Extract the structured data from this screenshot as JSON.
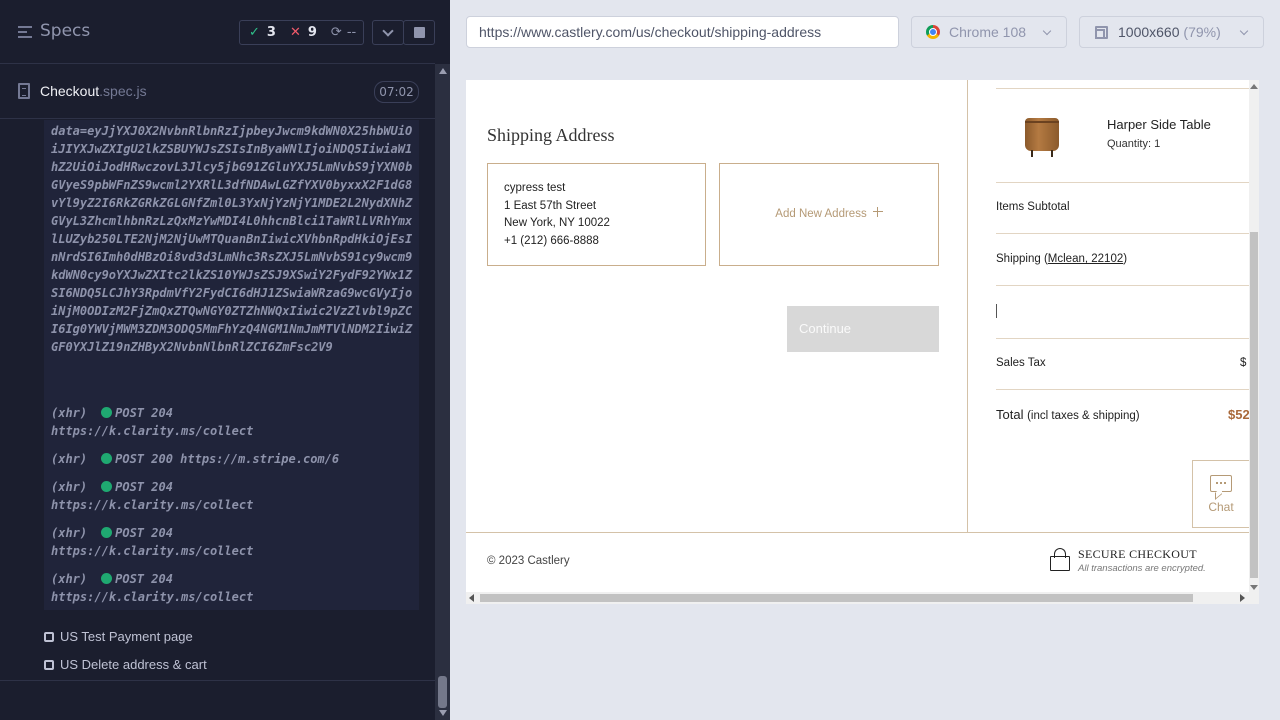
{
  "runner": {
    "title": "Specs",
    "stats": {
      "passed": "3",
      "failed": "9",
      "pending": "--"
    },
    "spec": {
      "name": "Checkout",
      "extension": ".spec.js",
      "duration": "07:02"
    },
    "command_log": {
      "encoded_payload": "data=eyJjYXJ0X2NvbnRlbnRzIjpbeyJwcm9kdWN0X25hbWUiOiJIYXJwZXIgU2lkZSBUYWJsZSIsInByaWNlIjoiNDQ5IiwiaW1hZ2UiOiJodHRwczovL3Jlcy5jbG91ZGluYXJ5LmNvbS9jYXN0bGVyeS9pbWFnZS9wcml2YXRlL3dfNDAwLGZfYXV0byxxX2F1dG8vYl9yZ2I6RkZGRkZGLGNfZml0L3YxNjYzNjY1MDE2L2NydXNhZGVyL3ZhcmlhbnRzLzQxMzYwMDI4L0hhcnBlci1TaWRlLVRhYmxlLUZyb250LTE2NjM2NjUwMTQuanBnIiwicXVhbnRpdHkiOjEsInNrdSI6Imh0dHBzOi8vd3d3LmNhc3RsZXJ5LmNvbS91cy9wcm9kdWN0cy9oYXJwZXItc2lkZS10YWJsZSJ9XSwiY2FydF92YWx1ZSI6NDQ5LCJhY3RpdmVfY2FydCI6dHJ1ZSwiaWRzaG9wcGVyIjoiNjM0ODIzM2FjZmQxZTQwNGY0ZTZhNWQxIiwic2VzZlvbl9pZCI6Ig0YWVjMWM3ZDM3ODQ5MmFhYzQ4NGM1NmJmMTVlNDM2IiwiZGF0YXJlZ19nZHByX2NvbnNlbnRlZCI6ZmFsc2V9",
      "entries": [
        {
          "type": "(xhr)",
          "method": "POST 204",
          "url": "https://k.clarity.ms/collect"
        },
        {
          "type": "(xhr)",
          "method": "POST 200",
          "url": "https://m.stripe.com/6"
        },
        {
          "type": "(xhr)",
          "method": "POST 204",
          "url": "https://k.clarity.ms/collect"
        },
        {
          "type": "(xhr)",
          "method": "POST 204",
          "url": "https://k.clarity.ms/collect"
        },
        {
          "type": "(xhr)",
          "method": "POST 204",
          "url": "https://k.clarity.ms/collect"
        }
      ]
    },
    "tests": [
      "US Test Payment page",
      "US Delete address & cart"
    ]
  },
  "browser": {
    "url": "https://www.castlery.com/us/checkout/shipping-address",
    "name": "Chrome 108",
    "viewport": "1000x660",
    "zoom": "(79%)"
  },
  "page": {
    "heading": "Shipping Address",
    "address": [
      "cypress test",
      "1 East 57th Street",
      "New York, NY 10022",
      "+1 (212) 666-8888"
    ],
    "add_new_label": "Add New Address",
    "continue_label": "Continue",
    "summary": {
      "product_name": "Harper Side Table",
      "product_qty": "Quantity: 1",
      "subtotal_label": "Items Subtotal",
      "shipping_label": "Shipping (",
      "shipping_location": "Mclean, 22102",
      "shipping_close": ")",
      "tax_label": "Sales Tax",
      "tax_value": "$",
      "total_label": "Total",
      "total_note": "(incl taxes & shipping)",
      "total_value": "$52"
    },
    "chat_label": "Chat",
    "copyright": "© 2023 Castlery",
    "secure_title": "SECURE CHECKOUT",
    "secure_sub": "All transactions are encrypted."
  },
  "colors": {
    "pass": "#2fc18a",
    "fail": "#f15a6a",
    "brand_gold": "#b59a76",
    "total": "#a9693a"
  }
}
